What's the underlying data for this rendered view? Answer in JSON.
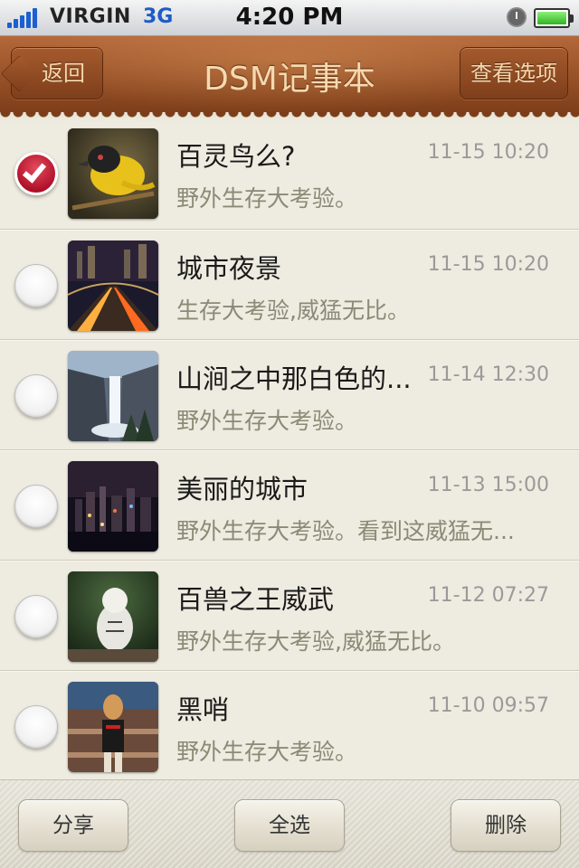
{
  "status_bar": {
    "carrier": "VIRGIN",
    "network": "3G",
    "time": "4:20 PM",
    "signal_bars": 5,
    "battery_level": 1.0,
    "icons": [
      "signal-icon",
      "alarm-icon",
      "battery-icon"
    ]
  },
  "nav": {
    "back_label": "返回",
    "title": "DSM记事本",
    "options_label": "查看选项"
  },
  "notes": [
    {
      "title": "百灵鸟么?",
      "time": "11-15 10:20",
      "desc": "野外生存大考验。",
      "checked": true,
      "thumbnail": "yellow-bird-photo"
    },
    {
      "title": "城市夜景",
      "time": "11-15 10:20",
      "desc": "生存大考验,威猛无比。",
      "checked": false,
      "thumbnail": "city-night-bridge-photo"
    },
    {
      "title": "山涧之中那白色的...",
      "time": "11-14 12:30",
      "desc": "野外生存大考验。",
      "checked": false,
      "thumbnail": "waterfall-photo"
    },
    {
      "title": "美丽的城市",
      "time": "11-13 15:00",
      "desc": "野外生存大考验。看到这威猛无...",
      "checked": false,
      "thumbnail": "city-skyline-photo"
    },
    {
      "title": "百兽之王威武",
      "time": "11-12 07:27",
      "desc": "野外生存大考验,威猛无比。",
      "checked": false,
      "thumbnail": "white-tiger-photo"
    },
    {
      "title": "黑哨",
      "time": "11-10 09:57",
      "desc": "野外生存大考验。",
      "checked": false,
      "thumbnail": "referee-photo"
    }
  ],
  "toolbar": {
    "share_label": "分享",
    "select_all_label": "全选",
    "delete_label": "删除"
  },
  "colors": {
    "nav_leather": "#8e4a22",
    "nav_text": "#f6d9ae",
    "check_red": "#b0122a",
    "list_background": "#eeebe0",
    "time_gray": "#9a9a9a",
    "desc_olive": "#8a8a76"
  }
}
